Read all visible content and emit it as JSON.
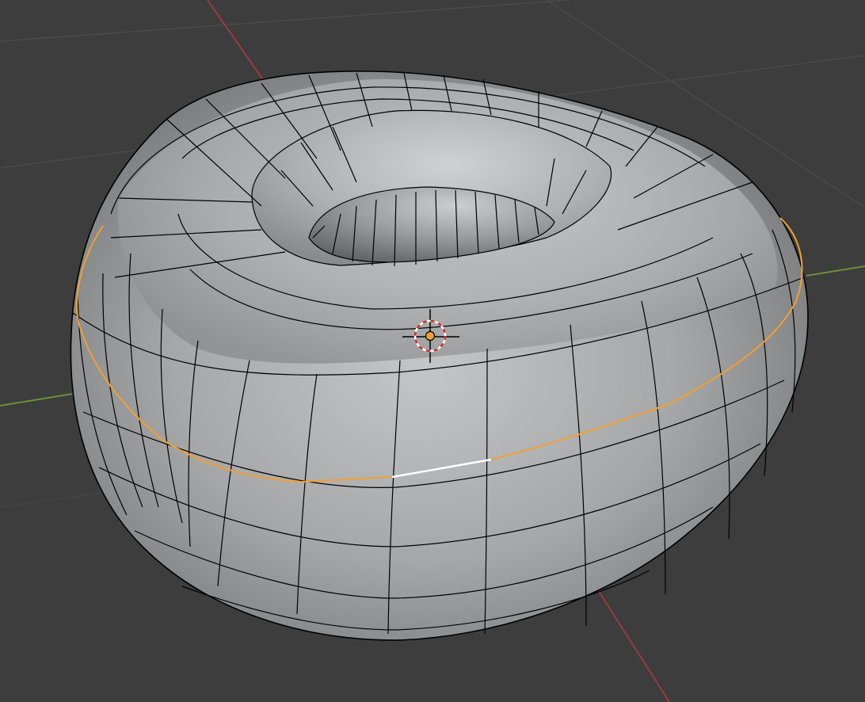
{
  "viewport": {
    "app": "3D viewport",
    "mode": "edit-mode",
    "object": "torus-mesh"
  },
  "colors": {
    "background": "#3d3d3d",
    "grid": "#4a4a4a",
    "x_axis": "#9a3a44",
    "y_axis": "#6d8f3a",
    "mesh_light": "#c2c4c5",
    "mesh_mid": "#9d9e9f",
    "mesh_dark": "#6f7071",
    "wire": "#000000",
    "edge_loop_selected": "#f0a033",
    "edge_active": "#ffffff",
    "origin": "#f0a033",
    "cursor_ring_red": "#d12a2a",
    "cursor_ring_white": "#ffffff"
  },
  "icons": {
    "cursor": "3d-cursor-icon",
    "origin": "object-origin-icon"
  }
}
